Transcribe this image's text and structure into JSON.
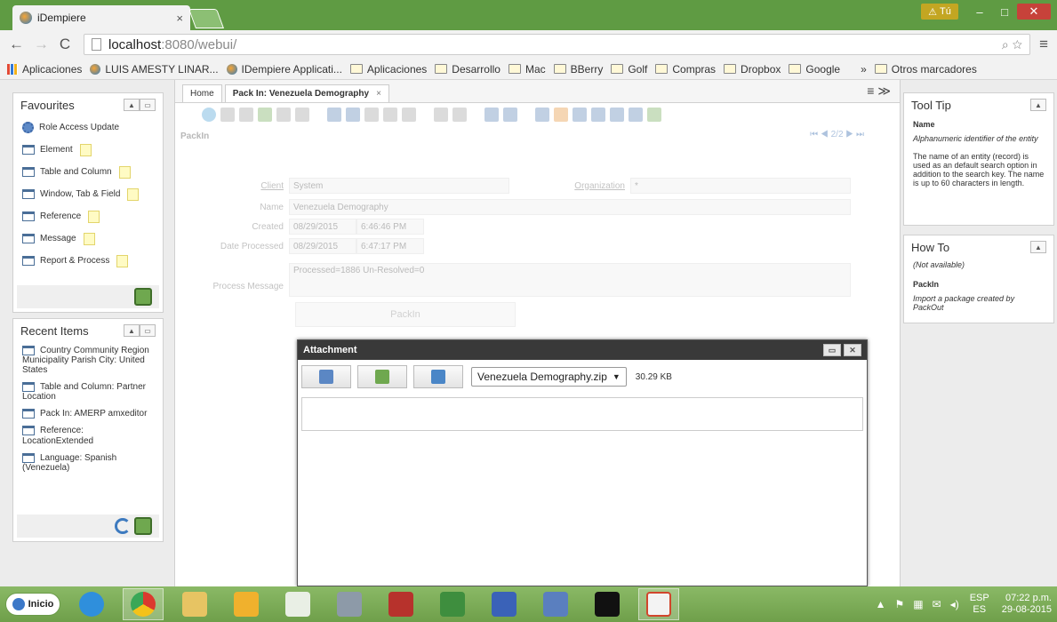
{
  "browser": {
    "tab_title": "iDempiere",
    "tab_close": "×",
    "user_badge": "Tú",
    "url_host": "localhost",
    "url_rest": ":8080/webui/",
    "bookmarks": [
      "Aplicaciones",
      "LUIS AMESTY LINAR...",
      "IDempiere Applicati...",
      "Aplicaciones",
      "Desarrollo",
      "Mac",
      "BBerry",
      "Golf",
      "Compras",
      "Dropbox",
      "Google"
    ],
    "bookmarks_more": "»",
    "other_bookmarks": "Otros marcadores"
  },
  "favourites": {
    "title": "Favourites",
    "items": [
      "Role Access Update",
      "Element",
      "Table and Column",
      "Window, Tab & Field",
      "Reference",
      "Message",
      "Report & Process"
    ]
  },
  "recent": {
    "title": "Recent Items",
    "items": [
      "Country Community Region Municipality Parish City: United States",
      "Table and Column: Partner Location",
      "Pack In: AMERP amxeditor",
      "Reference: LocationExtended",
      "Language: Spanish (Venezuela)"
    ]
  },
  "tabs": {
    "home": "Home",
    "active": "Pack In: Venezuela Demography",
    "close": "×"
  },
  "form": {
    "title": "PackIn",
    "record_nav": "2/2",
    "client_label": "Client",
    "client_value": "System",
    "org_label": "Organization",
    "org_value": "*",
    "name_label": "Name",
    "name_value": "Venezuela Demography",
    "created_label": "Created",
    "created_date": "08/29/2015",
    "created_time": "6:46:46 PM",
    "processed_label": "Date Processed",
    "processed_date": "08/29/2015",
    "processed_time": "6:47:17 PM",
    "message_label": "Process Message",
    "message_value": "Processed=1886 Un-Resolved=0",
    "packin_button": "PackIn"
  },
  "attachment": {
    "title": "Attachment",
    "file": "Venezuela Demography.zip",
    "size": "30.29 KB"
  },
  "tooltip": {
    "title": "Tool Tip",
    "field": "Name",
    "desc": "Alphanumeric identifier of the entity",
    "help": "The name of an entity (record) is used as an default search option in addition to the search key. The name is up to 60 characters in length."
  },
  "howto": {
    "title": "How To",
    "na": "(Not available)",
    "field": "PackIn",
    "desc": "Import a package created by PackOut"
  },
  "taskbar": {
    "start": "Inicio",
    "lang_top": "ESP",
    "lang_bottom": "ES",
    "time": "07:22 p.m.",
    "date": "29-08-2015"
  }
}
